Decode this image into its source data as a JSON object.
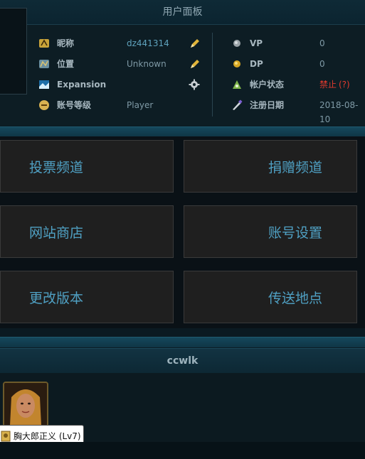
{
  "panel": {
    "title": "用户面板"
  },
  "profile": {
    "left": [
      {
        "label": "昵称",
        "value": "dz441314",
        "icon": "signature-icon",
        "action": "pencil-icon"
      },
      {
        "label": "位置",
        "value": "Unknown",
        "icon": "map-icon",
        "action": "pencil-icon"
      },
      {
        "label": "Expansion",
        "value": "",
        "icon": "landscape-icon",
        "action": "gear-icon"
      },
      {
        "label": "账号等级",
        "value": "Player",
        "icon": "helmet-icon"
      }
    ],
    "right": [
      {
        "label": "VP",
        "value": "0",
        "icon": "silver-coin-icon"
      },
      {
        "label": "DP",
        "value": "0",
        "icon": "gold-coin-icon"
      },
      {
        "label": "帐户状态",
        "value": "禁止",
        "help": "(?)",
        "icon": "status-icon"
      },
      {
        "label": "注册日期",
        "value": "2018-08-10",
        "icon": "quill-icon"
      }
    ]
  },
  "tiles": [
    "投票频道",
    "捐赠频道",
    "网站商店",
    "账号设置",
    "更改版本",
    "传送地点"
  ],
  "character": {
    "account_name": "ccwlk",
    "tooltip": "胸大郎正义 (Lv7)"
  },
  "colors": {
    "accent": "#4fa0c3",
    "error": "#e03a2e",
    "background": "#0b1a22"
  }
}
